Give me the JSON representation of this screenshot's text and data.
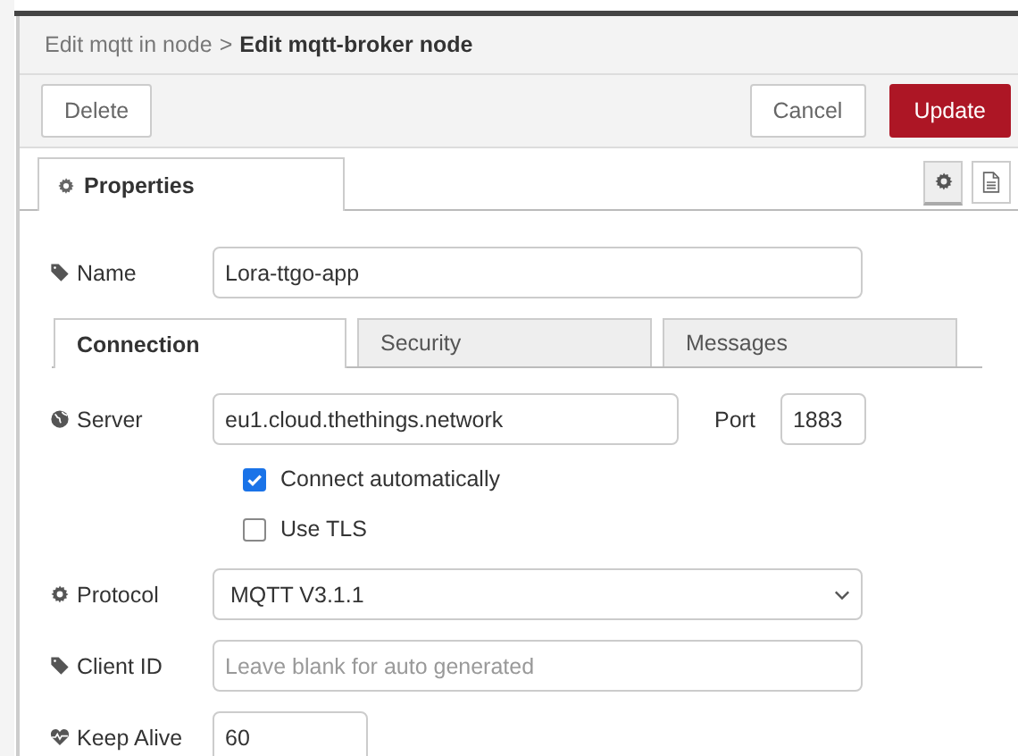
{
  "breadcrumb": {
    "parent": "Edit mqtt in node",
    "separator": ">",
    "current": "Edit mqtt-broker node"
  },
  "toolbar": {
    "left": [
      {
        "label": "Delete",
        "kind": "plain"
      }
    ],
    "right": [
      {
        "label": "Cancel",
        "kind": "plain"
      },
      {
        "label": "Update",
        "kind": "primary"
      }
    ]
  },
  "tabs": [
    {
      "label": "Properties",
      "selected": true
    }
  ],
  "side_buttons": [
    {
      "kind": "settings",
      "selected": true
    },
    {
      "kind": "description",
      "selected": false
    }
  ],
  "name": {
    "label": "Name",
    "value": "Lora-ttgo-app"
  },
  "section_tabs": [
    {
      "label": "Connection",
      "selected": true
    },
    {
      "label": "Security",
      "selected": false
    },
    {
      "label": "Messages",
      "selected": false
    }
  ],
  "server": {
    "label": "Server",
    "value": "eu1.cloud.thethings.network"
  },
  "port": {
    "label": "Port",
    "value": "1883"
  },
  "options": [
    {
      "label": "Connect automatically",
      "checked": true
    },
    {
      "label": "Use TLS",
      "checked": false
    }
  ],
  "protocol": {
    "label": "Protocol",
    "value": "MQTT V3.1.1"
  },
  "client_id": {
    "label": "Client ID",
    "placeholder": "Leave blank for auto generated"
  },
  "keep_alive": {
    "label": "Keep Alive",
    "value": "60"
  }
}
